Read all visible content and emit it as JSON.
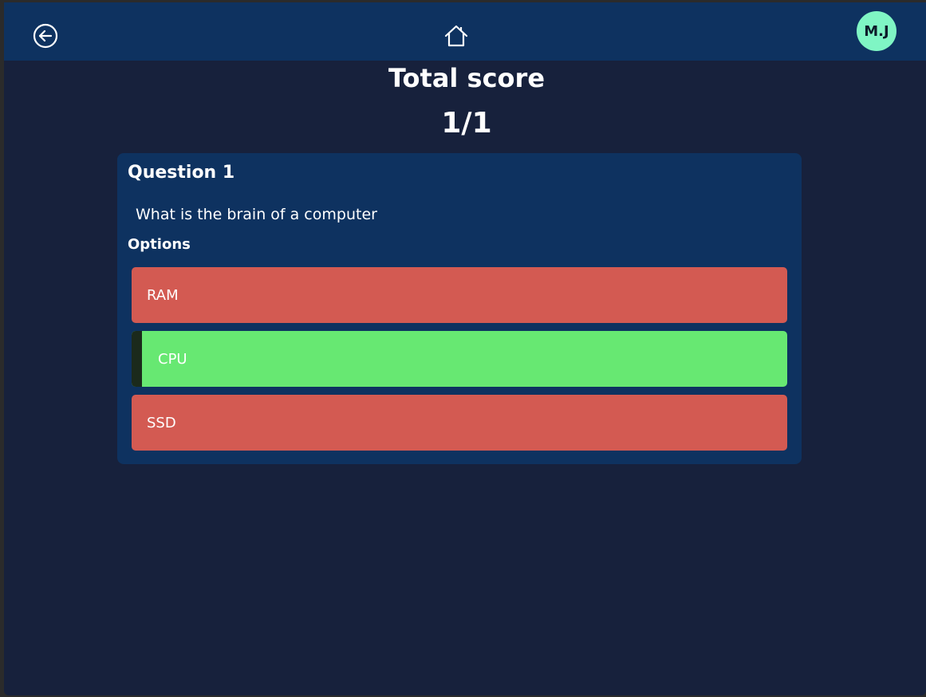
{
  "header": {
    "back_icon": "arrow-left-circle-icon",
    "home_icon": "home-icon",
    "avatar_initials": "M.J"
  },
  "score": {
    "title": "Total score",
    "value": "1/1"
  },
  "question": {
    "title": "Question 1",
    "text": "What is the brain of a computer",
    "options_label": "Options",
    "options": [
      {
        "label": "RAM",
        "status": "wrong"
      },
      {
        "label": "CPU",
        "status": "correct"
      },
      {
        "label": "SSD",
        "status": "wrong"
      }
    ]
  },
  "colors": {
    "background": "#17213c",
    "header": "#0e3260",
    "card": "#0e3260",
    "avatar": "#7ff5c4",
    "correct": "#67e872",
    "wrong": "#d35a52"
  }
}
